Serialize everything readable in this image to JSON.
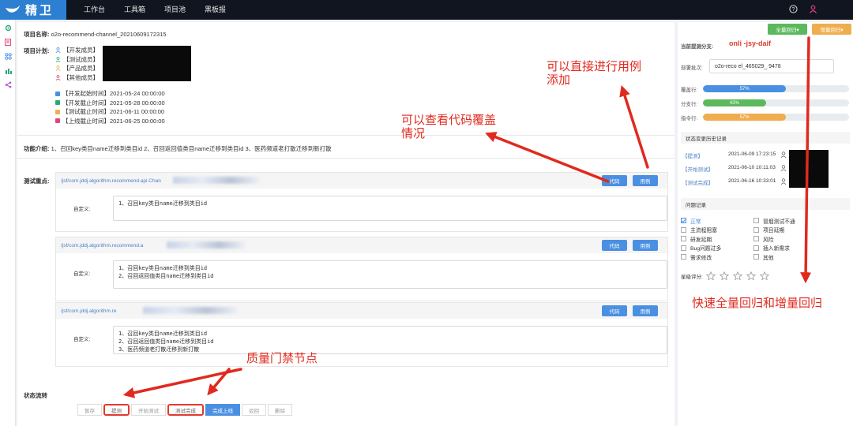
{
  "app": {
    "name": "精卫"
  },
  "nav": [
    "工作台",
    "工具箱",
    "项目池",
    "黑板报"
  ],
  "project": {
    "name_label": "项目名称:",
    "name_value": "o2o-recommend-channel_20210609172315",
    "plan_label": "项目计划:",
    "members": [
      "【开发成员】",
      "【测试成员】",
      "【产品成员】",
      "【其他成员】"
    ],
    "times": [
      "【开发起始时间】2021-05-24 00:00:00",
      "【开发截止时间】2021-05-28 00:00:00",
      "【测试截止时间】2021-06-11 00:00:00",
      "【上线截止时间】2021-06-25 00:00:00"
    ],
    "func_label": "功能介绍:",
    "func_value": "1、召回key类目name迁移到类目id 2、召回返回值类目name迁移到类目id 3、医药频道老打散迁移到新打散",
    "test_label": "测试重点:"
  },
  "cases": [
    {
      "path": "/jsf/com.jddj.algorithm.recommend.api.Chan",
      "code_btn": "代码",
      "case_btn": "用例",
      "custom_label": "自定义:",
      "text": [
        "1、召回key类目name迁移到类目id"
      ]
    },
    {
      "path": "/jsf/com.jddj.algorithm.recommend.a",
      "code_btn": "代码",
      "case_btn": "用例",
      "custom_label": "自定义:",
      "text": [
        "1、召回key类目name迁移到类目id",
        "2、召回返回值类目name迁移到类目id"
      ]
    },
    {
      "path": "/jsf/com.jddj.algorithm.re",
      "code_btn": "代码",
      "case_btn": "用例",
      "custom_label": "自定义:",
      "text": [
        "1、召回key类目name迁移到类目id",
        "2、召回返回值类目name迁移到类目id",
        "3、医药频道老打散迁移到新打散"
      ]
    }
  ],
  "flow": {
    "label": "状态流转",
    "steps": [
      "暂存",
      "提测",
      "开始测试",
      "测试完成",
      "完成上线",
      "驳回",
      "删除"
    ]
  },
  "side": {
    "full_btn": "全量回归▾",
    "inc_btn": "增量回归▾",
    "branch_label": "当前提测分支:",
    "branch_value": "onli     -jsy-daif",
    "deploy_label": "部署批次:",
    "deploy_value": "o2o-reco              el_465029_   9478",
    "coverage": [
      {
        "label": "覆盖行:",
        "percent": 57,
        "text": "57%",
        "color": "#4a90e2"
      },
      {
        "label": "分支行:",
        "percent": 43,
        "text": "43%",
        "color": "#5cb85c"
      },
      {
        "label": "指令行:",
        "percent": 57,
        "text": "57%",
        "color": "#f0ad4e"
      }
    ],
    "history_head": "状态变更历史记录",
    "history": [
      {
        "state": "【提测】",
        "time": "2021-06-09 17:23:15"
      },
      {
        "state": "【开始测试】",
        "time": "2021-06-10 10:11:03"
      },
      {
        "state": "【测试完成】",
        "time": "2021-06-16 10:33:01"
      }
    ],
    "issue_head": "问题记录",
    "issues": [
      [
        "正常",
        "冒烟测试不通"
      ],
      [
        "主流程阻塞",
        "项目延期"
      ],
      [
        "研发延期",
        "风险"
      ],
      [
        "Bug问题过多",
        "插入新需求"
      ],
      [
        "需求修改",
        "其他"
      ]
    ],
    "rating_label": "星级评分:",
    "rating": 0
  },
  "annotations": {
    "add_case": [
      "可以直接进行用例",
      "添加"
    ],
    "coverage": [
      "可以查看代码覆盖",
      "情况"
    ],
    "gate": "质量门禁节点",
    "regression": "快速全量回归和增量回归"
  },
  "colors": {
    "nav_bg": "#11151f",
    "brand": "#2d7fd1",
    "primary": "#4a90e2",
    "annotation": "#e02a1e"
  }
}
